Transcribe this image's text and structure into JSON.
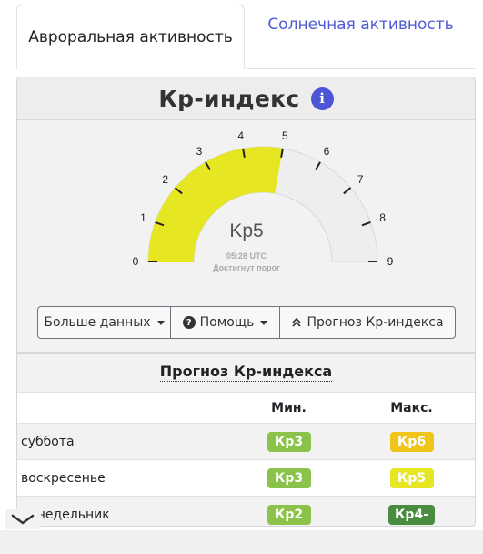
{
  "tabs": [
    {
      "label": "Авроральная активность",
      "active": true
    },
    {
      "label": "Солнечная активность",
      "active": false
    }
  ],
  "card": {
    "title": "Кр-индекс",
    "info_icon": "info-icon"
  },
  "gauge": {
    "value": 5,
    "display": "Kp5",
    "time": "05:28 UTC",
    "status": "Достигнут порог",
    "min": 0,
    "max": 9,
    "ticks": [
      "0",
      "1",
      "2",
      "3",
      "4",
      "5",
      "6",
      "7",
      "8",
      "9"
    ],
    "fill_color": "#e6e622",
    "track_color": "#eeeeee"
  },
  "buttons": {
    "more_data": "Больше данных",
    "help": "Помощь",
    "forecast": "Прогноз Кр-индекса"
  },
  "forecast": {
    "title": "Прогноз Кр-индекса",
    "columns": [
      "",
      "Мин.",
      "Макс."
    ],
    "rows": [
      {
        "day": "суббота",
        "min": {
          "text": "Кр3",
          "color": "#8bc34a"
        },
        "max": {
          "text": "Кр6",
          "color": "#f0c419"
        }
      },
      {
        "day": "воскресенье",
        "min": {
          "text": "Кр3",
          "color": "#8bc34a"
        },
        "max": {
          "text": "Кр5",
          "color": "#e6e622"
        }
      },
      {
        "day": "понедельник",
        "min": {
          "text": "Кр2",
          "color": "#8bc34a"
        },
        "max": {
          "text": "Кр4-",
          "color": "#4a8c3f"
        }
      }
    ]
  },
  "icons": {
    "collapse": "chevron-down-icon",
    "forecast_button": "double-chevron-up-icon",
    "help": "question-circle-icon"
  }
}
